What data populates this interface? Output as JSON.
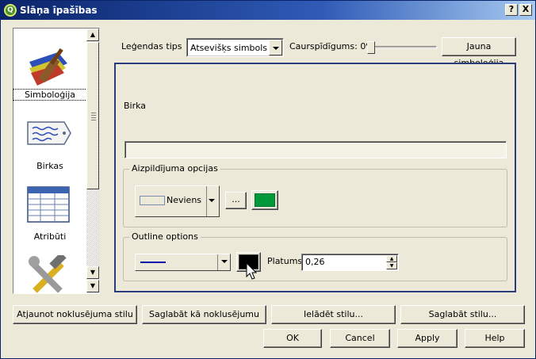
{
  "window": {
    "title": "Slāņa īpašības",
    "help_button": "?",
    "close_button": "X"
  },
  "sidebar": {
    "items": [
      {
        "label": "Simboloģija",
        "icon": "paintbrush-icon",
        "selected": true
      },
      {
        "label": "Birkas",
        "icon": "label-tag-icon",
        "selected": false
      },
      {
        "label": "Atribūti",
        "icon": "table-icon",
        "selected": false
      },
      {
        "label": "",
        "icon": "tools-icon",
        "selected": false
      }
    ]
  },
  "top_bar": {
    "legend_type_label": "Leģendas tips",
    "legend_type_value": "Atsevišķs simbols",
    "transparency_label": "Caurspīdīgums: 0%",
    "transparency_value_percent": 0,
    "new_symbology_button": "Jauna simboloģija"
  },
  "panel": {
    "label_caption": "Birka",
    "label_value": "",
    "fill_options": {
      "title": "Aizpildījuma opcijas",
      "fill_style_value": "Neviens",
      "browse_button": "...",
      "fill_color": "#00993a"
    },
    "outline_options": {
      "title": "Outline options",
      "line_style": "solid",
      "outline_color": "#000000",
      "width_label": "Platums",
      "width_value": "0,26"
    }
  },
  "bottom_row1": {
    "restore_default": "Atjaunot noklusējuma stilu",
    "save_as_default": "Saglabāt kā noklusējumu",
    "load_style": "Ielādēt stilu...",
    "save_style": "Saglabāt stilu..."
  },
  "bottom_row2": {
    "ok": "OK",
    "cancel": "Cancel",
    "apply": "Apply",
    "help": "Help"
  }
}
